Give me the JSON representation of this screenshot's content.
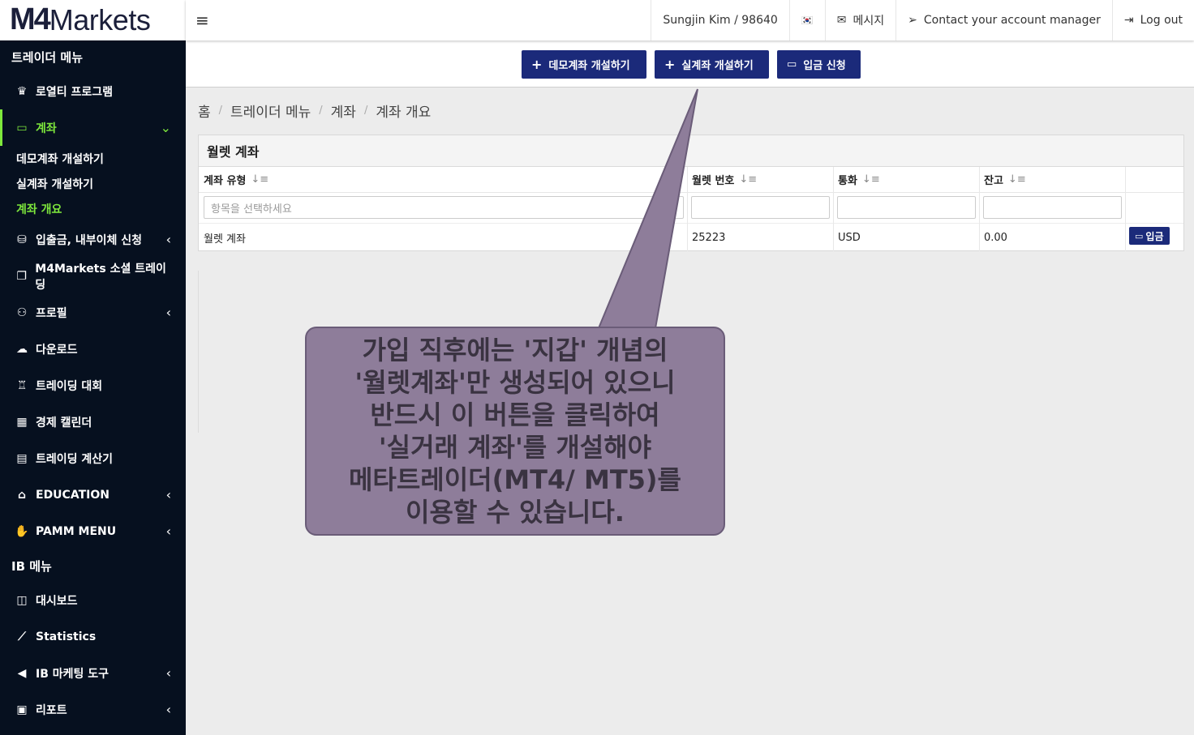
{
  "logo": {
    "prefix": "M4",
    "suffix": "Markets"
  },
  "sidebar": {
    "trader_section": "트레이더 메뉴",
    "items": [
      {
        "label": "로열티 프로그램",
        "icon": "crown-icon"
      },
      {
        "label": "계좌",
        "icon": "wallet-icon",
        "active": true
      },
      {
        "label": "입출금, 내부이체 신청",
        "icon": "coins-icon"
      },
      {
        "label": "M4Markets 소셜 트레이딩",
        "icon": "copy-icon"
      },
      {
        "label": "프로필",
        "icon": "user-icon"
      },
      {
        "label": "다운로드",
        "icon": "cloud-download-icon"
      },
      {
        "label": "트레이딩 대회",
        "icon": "trophy-icon"
      },
      {
        "label": "경제 캘린더",
        "icon": "calendar-icon"
      },
      {
        "label": "트레이딩 계산기",
        "icon": "calculator-icon"
      },
      {
        "label": "EDUCATION",
        "icon": "graduation-cap-icon"
      },
      {
        "label": "PAMM MENU",
        "icon": "hand-coin-icon"
      }
    ],
    "subitems": [
      "데모계좌 개설하기",
      "실계좌 개설하기",
      "계좌 개요"
    ],
    "ib_section": "IB 메뉴",
    "ib_items": [
      {
        "label": "대시보드",
        "icon": "dashboard-icon"
      },
      {
        "label": "Statistics",
        "icon": "chart-line-icon"
      },
      {
        "label": "IB 마케팅 도구",
        "icon": "megaphone-icon"
      },
      {
        "label": "리포트",
        "icon": "report-icon"
      }
    ]
  },
  "topbar": {
    "user": "Sungjin Kim / 98640",
    "flag": "🇰🇷",
    "messages": "메시지",
    "contact": "Contact your account manager",
    "logout": "Log out"
  },
  "actions": {
    "demo": "데모계좌 개설하기",
    "live": "실계좌 개설하기",
    "deposit": "입금 신청"
  },
  "breadcrumb": [
    "홈",
    "트레이더 메뉴",
    "계좌",
    "계좌 개요"
  ],
  "wallet_panel": {
    "title": "월렛 계좌",
    "headers": [
      "계좌 유형",
      "월렛 번호",
      "통화",
      "잔고"
    ],
    "select_placeholder": "항목을 선택하세요",
    "row": {
      "type": "월렛 계좌",
      "number": "25223",
      "currency": "USD",
      "balance": "0.00",
      "action": "입금"
    }
  },
  "callout": {
    "lines": [
      "가입 직후에는 '지갑' 개념의",
      "'월렛계좌'만 생성되어 있으니",
      "반드시 이 버튼을 클릭하여",
      "'실거래 계좌'를 개설해야",
      "메타트레이더(MT4/ MT5)를",
      "이용할 수 있습니다."
    ]
  }
}
